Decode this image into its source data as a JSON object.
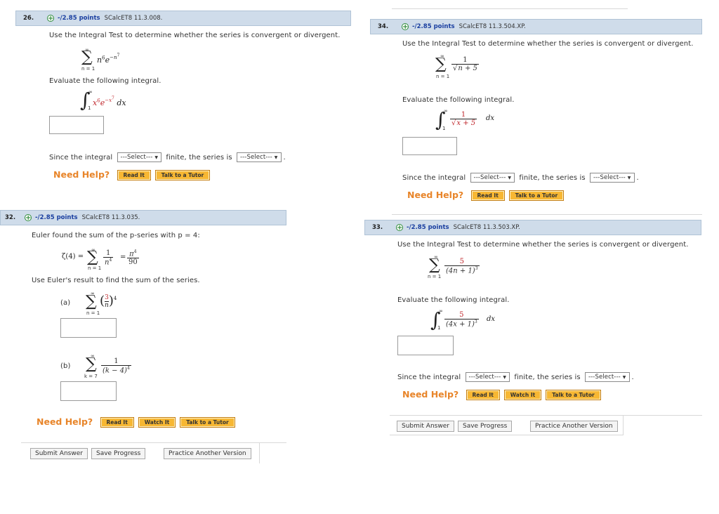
{
  "q26": {
    "num": "26.",
    "points": "-/2.85 points",
    "code": "SCalcET8 11.3.008.",
    "prompt": "Use the Integral Test to determine whether the series is convergent or divergent.",
    "eval_prompt": "Evaluate the following integral.",
    "since_a": "Since the integral",
    "since_b": "finite, the series is",
    "select1": "---Select---",
    "select2": "---Select---",
    "need_help": "Need Help?",
    "read_it": "Read It",
    "talk": "Talk to a Tutor"
  },
  "q34": {
    "num": "34.",
    "points": "-/2.85 points",
    "code": "SCalcET8 11.3.504.XP.",
    "prompt": "Use the Integral Test to determine whether the series is convergent or divergent.",
    "eval_prompt": "Evaluate the following integral.",
    "since_a": "Since the integral",
    "since_b": "finite, the series is",
    "select1": "---Select---",
    "select2": "---Select---",
    "need_help": "Need Help?",
    "read_it": "Read It",
    "talk": "Talk to a Tutor"
  },
  "q32": {
    "num": "32.",
    "points": "-/2.85 points",
    "code": "SCalcET8 11.3.035.",
    "prompt": "Euler found the sum of the p-series with p = 4:",
    "use_prompt": "Use Euler's result to find the sum of the series.",
    "part_a": "(a)",
    "part_b": "(b)",
    "need_help": "Need Help?",
    "read_it": "Read It",
    "watch_it": "Watch It",
    "talk": "Talk to a Tutor",
    "submit": "Submit Answer",
    "save": "Save Progress",
    "practice": "Practice Another Version"
  },
  "q33": {
    "num": "33.",
    "points": "-/2.85 points",
    "code": "SCalcET8 11.3.503.XP.",
    "prompt": "Use the Integral Test to determine whether the series is convergent or divergent.",
    "eval_prompt": "Evaluate the following integral.",
    "since_a": "Since the integral",
    "since_b": "finite, the series is",
    "select1": "---Select---",
    "select2": "---Select---",
    "need_help": "Need Help?",
    "read_it": "Read It",
    "watch_it": "Watch It",
    "talk": "Talk to a Tutor",
    "submit": "Submit Answer",
    "save": "Save Progress",
    "practice": "Practice Another Version"
  },
  "math": {
    "inf": "∞",
    "n1": "n = 1",
    "k7": "k = 7",
    "one": "1",
    "five": "5",
    "dx": "dx",
    "n6": "n",
    "six": "6",
    "e": "e",
    "exp26": "−n",
    "seven": "7",
    "x6": "x",
    "expx": "−x",
    "sqrt_n5": "n + 5",
    "sqrt_x5": "x + 5",
    "den33": "(4n + 1)",
    "den33i": "(4x + 1)",
    "cube": "3",
    "zeta": "ζ(4) =",
    "eq": "=",
    "pi4": "π",
    "four": "4",
    "ninety": "90",
    "n4": "n",
    "three": "3",
    "nn": "n",
    "km4": "(k − 4)"
  },
  "colors": {
    "header_bg": "#cfdcea",
    "points": "#1a3fa0",
    "need_help": "#e8852a",
    "button": "#f7b733",
    "red": "#c0282d"
  }
}
